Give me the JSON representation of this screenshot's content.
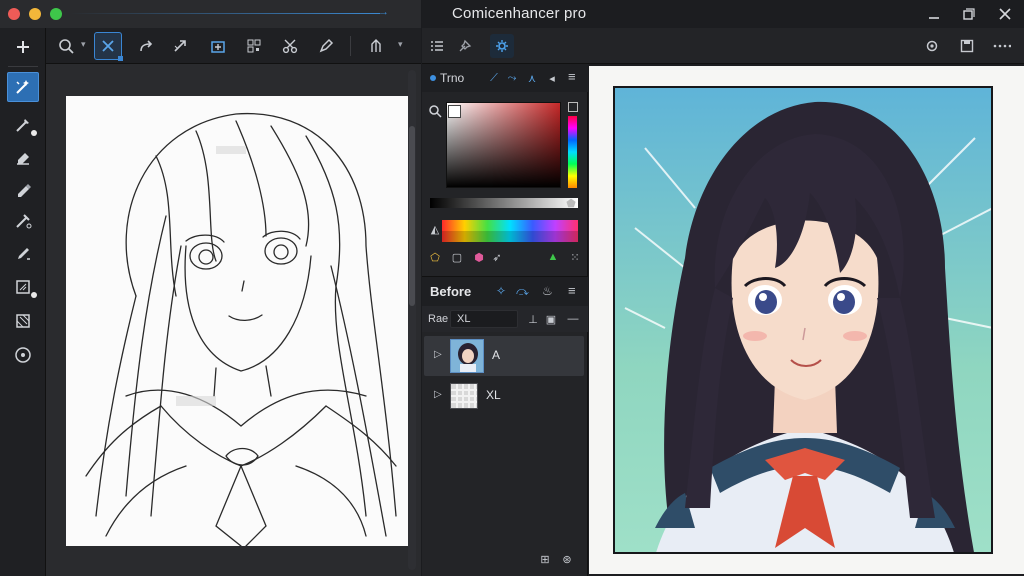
{
  "window_title": "Comicenhancer pro",
  "left_window": {
    "top_toolbar": [
      {
        "icon": "search-icon"
      },
      {
        "icon": "lasso-icon",
        "active": true
      },
      {
        "icon": "redo-arrow-icon"
      },
      {
        "icon": "expand-icon"
      },
      {
        "icon": "layer-add-icon"
      },
      {
        "icon": "qr-grid-icon"
      },
      {
        "icon": "cut-icon"
      },
      {
        "icon": "pen-nib-icon"
      },
      {
        "icon": "perspective-icon"
      }
    ],
    "tool_strip": [
      {
        "icon": "plus-icon"
      },
      {
        "icon": "magic-wand-icon",
        "active": true
      },
      {
        "icon": "pipette-icon"
      },
      {
        "icon": "eraser-icon"
      },
      {
        "icon": "marker-icon"
      },
      {
        "icon": "ink-pen-icon"
      },
      {
        "icon": "brush-icon"
      },
      {
        "icon": "grid-transform-icon"
      },
      {
        "icon": "texture-icon"
      },
      {
        "icon": "radial-icon"
      }
    ]
  },
  "right_window": {
    "title": "Comicenhancer pro",
    "window_controls": [
      "minimize-icon",
      "restore-icon",
      "close-icon"
    ],
    "toolbar_left": [
      {
        "icon": "list-icon"
      },
      {
        "icon": "pin-icon"
      },
      {
        "icon": "settings-gear-icon",
        "active": true
      }
    ],
    "toolbar_right": [
      {
        "icon": "cog-icon"
      },
      {
        "icon": "save-icon"
      },
      {
        "icon": "more-dots-icon"
      }
    ],
    "color_panel": {
      "tab_label": "Trno",
      "foreground_color": "#ffffff",
      "box_hue": "#c62828"
    },
    "layers_panel": {
      "title": "Before",
      "sub_label": "Rae",
      "sub_value": "XL",
      "layers": [
        {
          "name": "A",
          "selected": true
        },
        {
          "name": "XL",
          "selected": false
        }
      ]
    }
  },
  "colors": {
    "accent": "#3a86d4",
    "panel_bg": "#232427",
    "title_bg": "#1c1d20"
  }
}
